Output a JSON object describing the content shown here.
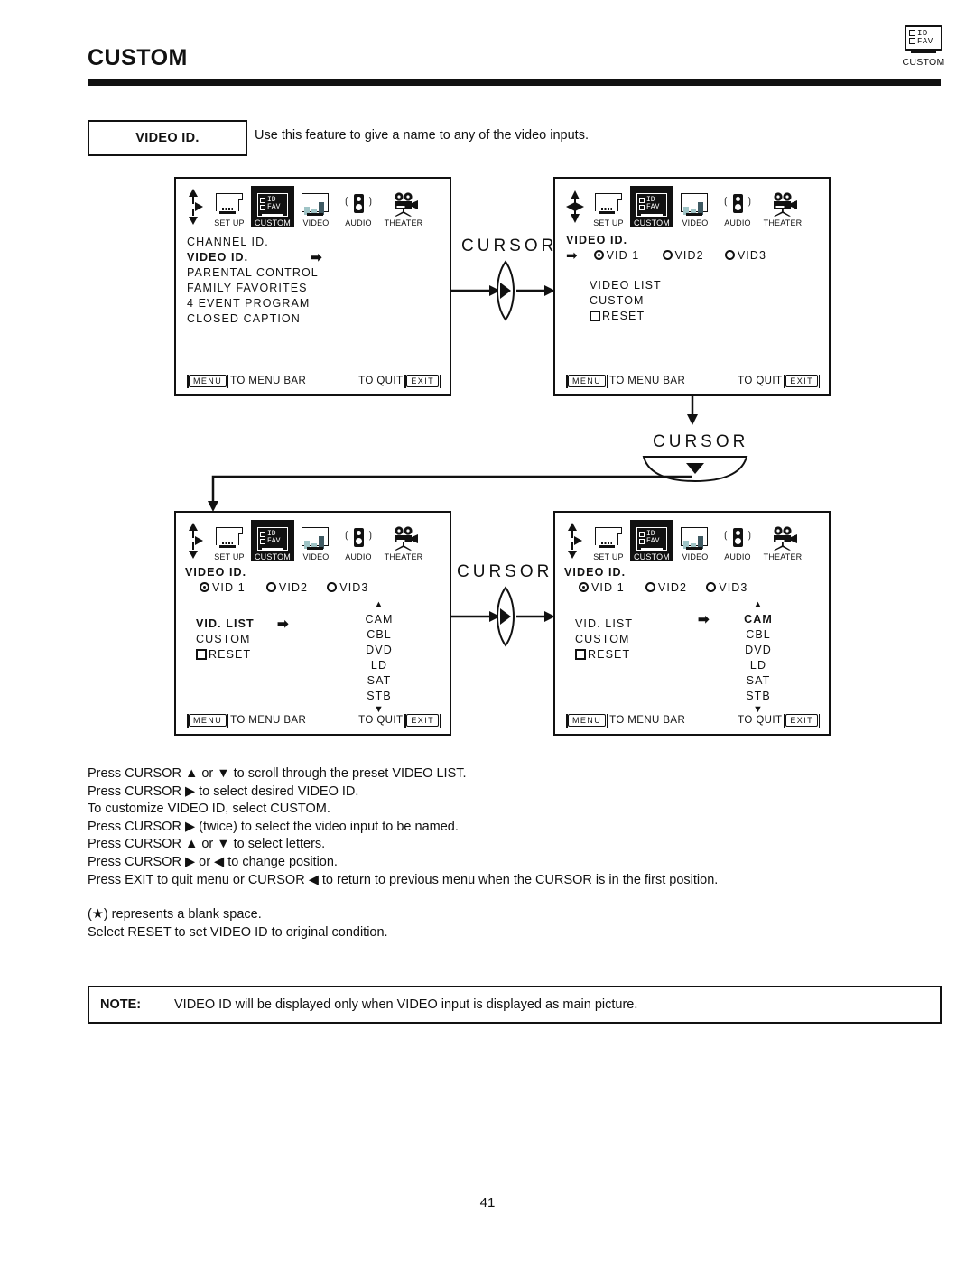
{
  "header": {
    "title": "CUSTOM",
    "corner_icon": "custom-idfav-icon",
    "corner_label": "CUSTOM"
  },
  "feature": {
    "label": "VIDEO ID.",
    "description": "Use this feature to give a name to any of the video inputs."
  },
  "menu_bar": {
    "items": [
      {
        "label": "SET UP",
        "icon": "tv-setup-icon",
        "selected": false
      },
      {
        "label": "CUSTOM",
        "icon": "id-fav-icon",
        "selected": true
      },
      {
        "label": "VIDEO",
        "icon": "video-bars-icon",
        "selected": false
      },
      {
        "label": "AUDIO",
        "icon": "speaker-icon",
        "selected": false
      },
      {
        "label": "THEATER",
        "icon": "movie-camera-icon",
        "selected": false
      }
    ]
  },
  "panels": {
    "p1": {
      "nav_icon": "up-right-down-arrows-icon",
      "items": [
        "CHANNEL ID.",
        "VIDEO ID.",
        "PARENTAL CONTROL",
        "FAMILY FAVORITES",
        "4 EVENT PROGRAM",
        "CLOSED CAPTION"
      ],
      "highlighted_item": "VIDEO ID.",
      "cursor_arrow": "right-arrow-icon",
      "footer": {
        "menu_key": "MENU",
        "menu_text": "TO MENU BAR",
        "quit_text": "TO QUIT",
        "exit_key": "EXIT"
      }
    },
    "p2": {
      "nav_icon": "four-way-arrows-icon",
      "title": "VIDEO ID.",
      "cursor_arrow": "right-arrow-icon",
      "inputs": [
        {
          "label": "VID 1",
          "selected": true
        },
        {
          "label": "VID2",
          "selected": false
        },
        {
          "label": "VID3",
          "selected": false
        }
      ],
      "options": [
        "VIDEO LIST",
        "CUSTOM"
      ],
      "reset_label": "RESET",
      "footer": {
        "menu_key": "MENU",
        "menu_text": "TO MENU BAR",
        "quit_text": "TO QUIT",
        "exit_key": "EXIT"
      }
    },
    "p3": {
      "nav_icon": "up-right-down-arrows-icon",
      "title": "VIDEO ID.",
      "inputs": [
        {
          "label": "VID 1",
          "selected": true
        },
        {
          "label": "VID2",
          "selected": false
        },
        {
          "label": "VID3",
          "selected": false
        }
      ],
      "options": [
        "VID.  LIST",
        "CUSTOM"
      ],
      "highlighted_option": "VID.  LIST",
      "cursor_arrow": "right-arrow-icon",
      "reset_label": "RESET",
      "video_list": [
        "CAM",
        "CBL",
        "DVD",
        "LD",
        "SAT",
        "STB"
      ],
      "list_scroll_up": "up-triangle-icon",
      "list_scroll_down": "down-triangle-icon",
      "footer": {
        "menu_key": "MENU",
        "menu_text": "TO MENU BAR",
        "quit_text": "TO QUIT",
        "exit_key": "EXIT"
      }
    },
    "p4": {
      "nav_icon": "up-right-down-arrows-icon",
      "title": "VIDEO ID.",
      "inputs": [
        {
          "label": "VID 1",
          "selected": true
        },
        {
          "label": "VID2",
          "selected": false
        },
        {
          "label": "VID3",
          "selected": false
        }
      ],
      "options": [
        "VID.  LIST",
        "CUSTOM"
      ],
      "reset_label": "RESET",
      "video_list": [
        "CAM",
        "CBL",
        "DVD",
        "LD",
        "SAT",
        "STB"
      ],
      "highlighted_list_item": "CAM",
      "cursor_arrow": "right-arrow-icon",
      "list_scroll_up": "up-triangle-icon",
      "list_scroll_down": "down-triangle-icon",
      "footer": {
        "menu_key": "MENU",
        "menu_text": "TO MENU BAR",
        "quit_text": "TO QUIT",
        "exit_key": "EXIT"
      }
    }
  },
  "connectors": {
    "cursor_right_top": {
      "label": "CURSOR",
      "direction": "right"
    },
    "cursor_down_mid": {
      "label": "CURSOR",
      "direction": "down"
    },
    "cursor_right_bottom": {
      "label": "CURSOR",
      "direction": "right"
    }
  },
  "instructions": {
    "lines": [
      "Press CURSOR ▲ or ▼ to scroll through the preset VIDEO LIST.",
      "Press CURSOR ▶ to select desired VIDEO ID.",
      "To customize VIDEO ID, select CUSTOM.",
      "Press CURSOR ▶ (twice) to select the video input to be named.",
      "Press CURSOR ▲ or ▼ to select letters.",
      "Press CURSOR ▶ or ◀ to change position.",
      "Press EXIT to quit menu or CURSOR ◀ to return to previous menu when the CURSOR is in the first position."
    ],
    "lines2": [
      "(★) represents a blank space.",
      "Select RESET to set VIDEO ID to original condition."
    ]
  },
  "note": {
    "label": "NOTE:",
    "text": "VIDEO ID will be displayed only when VIDEO input is displayed as main picture."
  },
  "page_number": "41"
}
